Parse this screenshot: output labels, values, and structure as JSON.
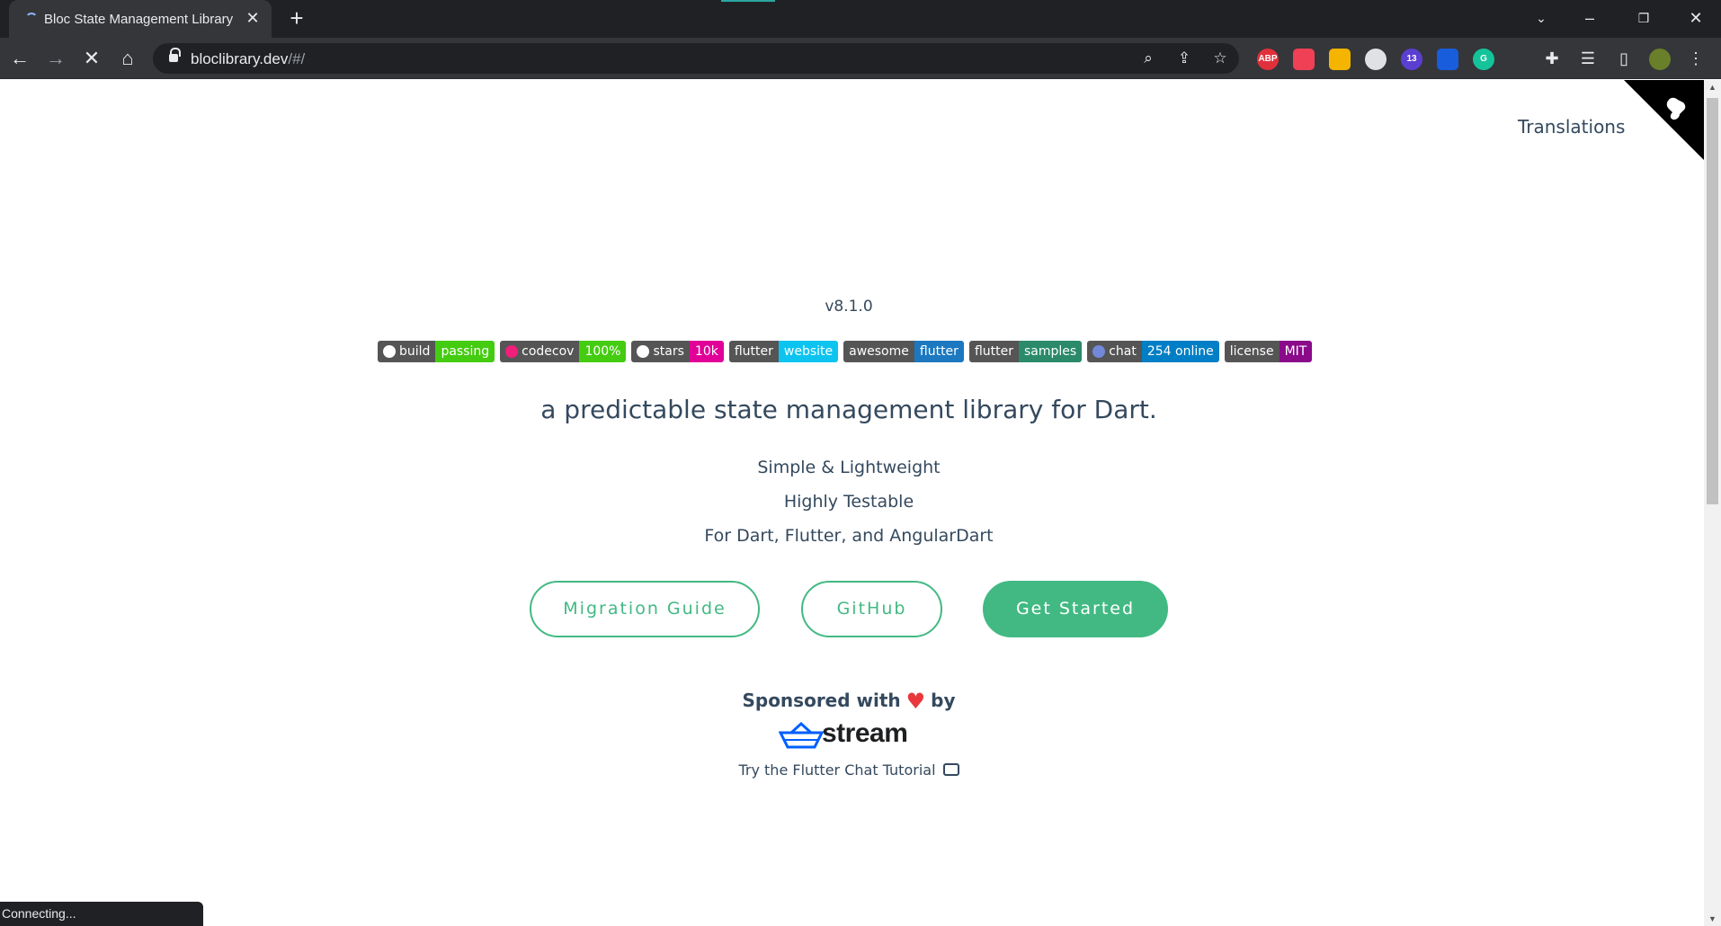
{
  "browser": {
    "tab_title": "Bloc State Management Library",
    "url_host": "bloclibrary.dev",
    "url_path": "/#/",
    "status_text": "Connecting...",
    "extensions": [
      {
        "name": "adblock-plus",
        "label": "ABP",
        "color": "#e0303c"
      },
      {
        "name": "pocket",
        "label": "",
        "color": "#ef4056"
      },
      {
        "name": "keep",
        "label": "",
        "color": "#f4b400"
      },
      {
        "name": "openai",
        "label": "",
        "color": "#dfe1e5"
      },
      {
        "name": "badge-ext",
        "label": "13",
        "color": "#5b3fd1"
      },
      {
        "name": "bitwarden",
        "label": "",
        "color": "#175ddc"
      },
      {
        "name": "grammarly",
        "label": "G",
        "color": "#15c39a"
      }
    ]
  },
  "page": {
    "translations_link": "Translations",
    "version": "v8.1.0",
    "badges": [
      {
        "label": "build",
        "value": "passing",
        "color": "#4c1",
        "icon": "github-icon"
      },
      {
        "label": "codecov",
        "value": "100%",
        "color": "#4c1",
        "icon": "codecov-icon"
      },
      {
        "label": "stars",
        "value": "10k",
        "color": "#e10098",
        "icon": "github-icon"
      },
      {
        "label": "flutter",
        "value": "website",
        "color": "#0dc4f0",
        "icon": ""
      },
      {
        "label": "awesome",
        "value": "flutter",
        "color": "#1c78c0",
        "icon": ""
      },
      {
        "label": "flutter",
        "value": "samples",
        "color": "#2a8a6a",
        "icon": ""
      },
      {
        "label": "chat",
        "value": "254 online",
        "color": "#007ec6",
        "icon": "discord-icon"
      },
      {
        "label": "license",
        "value": "MIT",
        "color": "#8a0a8a",
        "icon": ""
      }
    ],
    "tagline": "a predictable state management library for Dart.",
    "features": [
      "Simple & Lightweight",
      "Highly Testable",
      "For Dart, Flutter, and AngularDart"
    ],
    "buttons": {
      "migration": "Migration Guide",
      "github": "GitHub",
      "get_started": "Get Started"
    },
    "sponsor_before": "Sponsored with",
    "sponsor_after": "by",
    "sponsor_name": "stream",
    "tutorial_link": "Try the Flutter Chat Tutorial"
  },
  "colors": {
    "accent": "#42b983",
    "text": "#34495e"
  }
}
